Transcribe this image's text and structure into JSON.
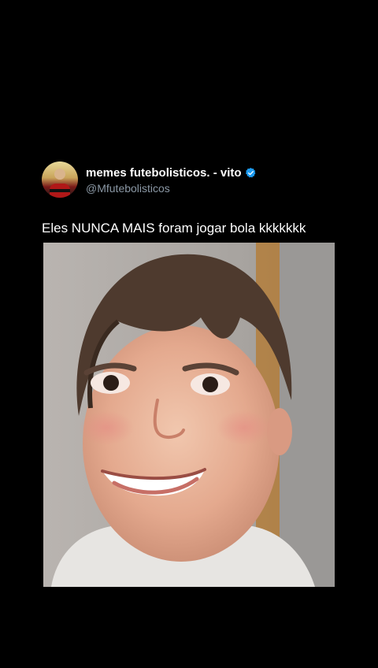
{
  "tweet": {
    "display_name": "memes futebolisticos. - vito",
    "handle": "@Mfutebolisticos",
    "text": "Eles NUNCA MAIS foram jogar bola kkkkkkk",
    "verified": true,
    "avatar_icon": "profile-avatar",
    "verified_icon": "verified-badge-icon",
    "media": {
      "type": "photo",
      "subject": "smiling-child-photo"
    }
  },
  "colors": {
    "background": "#000000",
    "text": "#ffffff",
    "secondary_text": "#8b98a5",
    "verified_blue": "#1d9bf0"
  }
}
